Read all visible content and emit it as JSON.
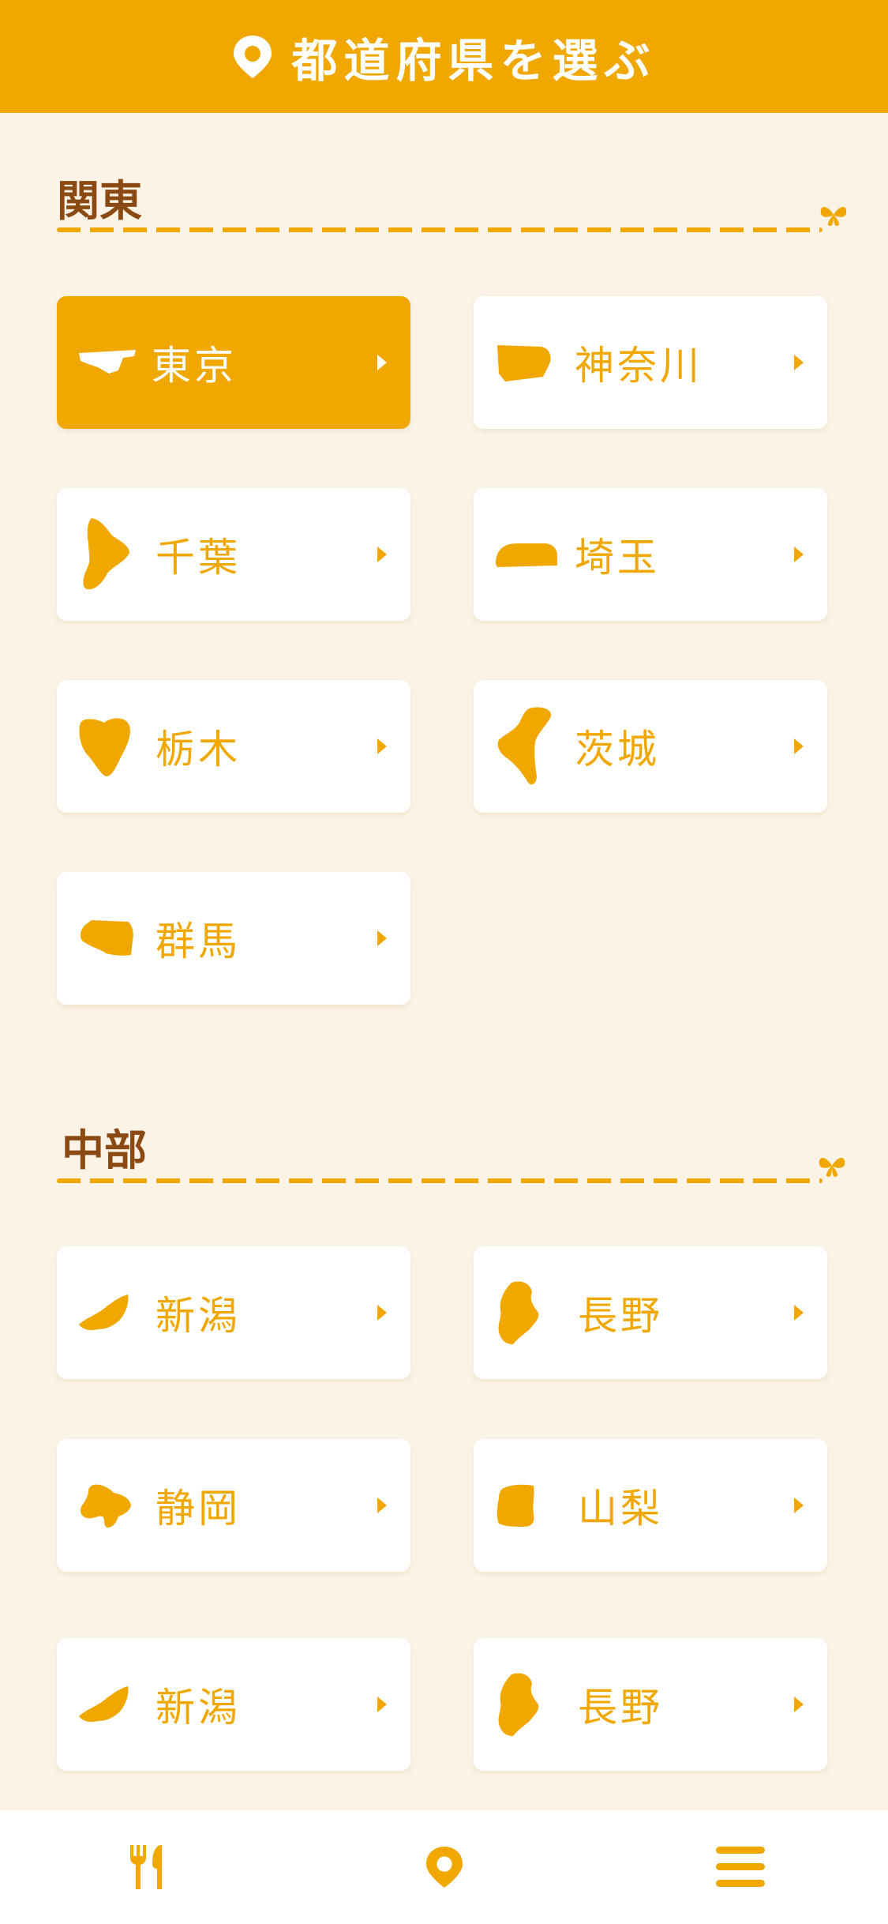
{
  "header": {
    "title": "都道府県を選ぶ",
    "icon": "map-pin-icon"
  },
  "accent": "#F0A800",
  "background": "#FAF3E6",
  "sections": [
    {
      "title": "関東",
      "items": [
        {
          "label": "東京",
          "selected": true
        },
        {
          "label": "神奈川"
        },
        {
          "label": "千葉"
        },
        {
          "label": "埼玉"
        },
        {
          "label": "栃木"
        },
        {
          "label": "茨城"
        },
        {
          "label": "群馬"
        }
      ]
    },
    {
      "title": "中部",
      "items": [
        {
          "label": "新潟"
        },
        {
          "label": "長野"
        },
        {
          "label": "静岡"
        },
        {
          "label": "山梨"
        },
        {
          "label": "新潟"
        },
        {
          "label": "長野"
        }
      ]
    }
  ],
  "tabbar": {
    "icons": [
      "restaurant-icon",
      "map-pin-icon",
      "menu-icon"
    ]
  }
}
